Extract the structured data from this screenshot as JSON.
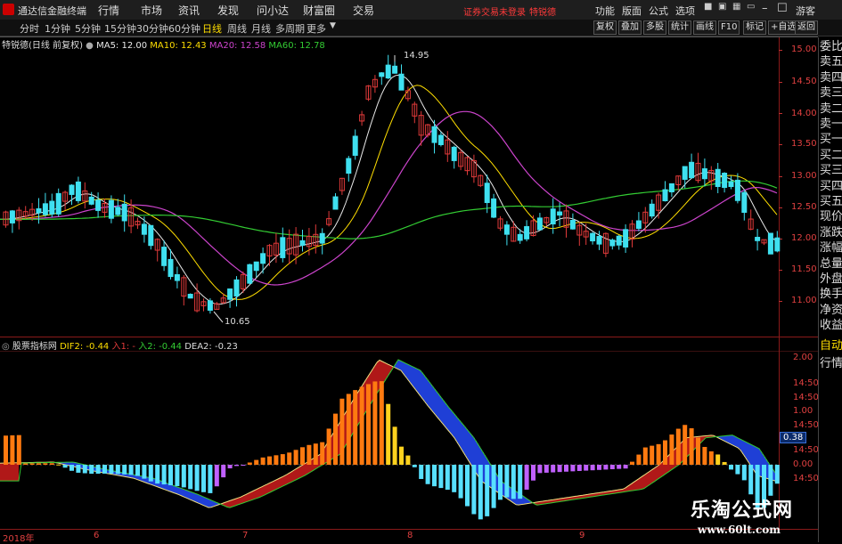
{
  "titlebar": {
    "app_name": "通达信金融终端",
    "menus": [
      "行情",
      "市场",
      "资讯",
      "发现",
      "问小达",
      "财富圈",
      "交易"
    ],
    "notice": "证券交易未登录",
    "stock_name": "特锐德",
    "right_menus": [
      "功能",
      "版面",
      "公式",
      "选项"
    ],
    "user": "游客",
    "win_min": "–",
    "win_max": "☐",
    "win_close": "✕"
  },
  "toolbar": {
    "periods": [
      "分时",
      "1分钟",
      "5分钟",
      "15分钟",
      "30分钟",
      "60分钟",
      "日线",
      "周线",
      "月线",
      "多周期",
      "更多"
    ],
    "active_period": "日线",
    "right_buttons": [
      "复权",
      "叠加",
      "多股",
      "统计",
      "画线",
      "F10",
      "标记",
      "+自选",
      "返回"
    ]
  },
  "main_info": {
    "title": "特锐德(日线 前复权)",
    "ma5": "MA5: 12.00",
    "ma10": "MA10: 12.43",
    "ma20": "MA20: 12.58",
    "ma60": "MA60: 12.78",
    "high_label": "14.95",
    "low_label": "10.65"
  },
  "indicator_info": {
    "name": "股票指标网",
    "dif": "DIF2: -0.44",
    "in1": "入1: -",
    "in2": "入2: -0.44",
    "dea": "DEA2: -0.23",
    "badge": "0.38"
  },
  "price_axis": [
    "15.00",
    "14.50",
    "14.00",
    "13.50",
    "13.00",
    "12.50",
    "12.00",
    "11.50",
    "11.00"
  ],
  "macd_axis": [
    "2.00",
    "14:50",
    "14:50",
    "1.00",
    "14:50",
    "14:50",
    "0.00",
    "14:50"
  ],
  "date_axis": [
    "2018年",
    "6",
    "7",
    "8",
    "9"
  ],
  "side_panel": [
    {
      "label": "委比",
      "hl": false
    },
    {
      "label": "卖五",
      "hl": false
    },
    {
      "label": "卖四",
      "hl": false
    },
    {
      "label": "卖三",
      "hl": false
    },
    {
      "label": "卖二",
      "hl": false
    },
    {
      "label": "卖一",
      "hl": false
    },
    {
      "label": "买一",
      "hl": false
    },
    {
      "label": "买二",
      "hl": false
    },
    {
      "label": "买三",
      "hl": false
    },
    {
      "label": "买四",
      "hl": false
    },
    {
      "label": "买五",
      "hl": false
    },
    {
      "label": "现价",
      "hl": false
    },
    {
      "label": "涨跌",
      "hl": false
    },
    {
      "label": "涨幅",
      "hl": false
    },
    {
      "label": "总量",
      "hl": false
    },
    {
      "label": "外盘",
      "hl": false
    },
    {
      "label": "换手",
      "hl": false
    },
    {
      "label": "净资",
      "hl": false
    },
    {
      "label": "收益",
      "hl": false
    },
    {
      "label": "自动",
      "hl": true
    },
    {
      "label": "行情",
      "hl": false
    }
  ],
  "watermark": {
    "line1": "乐淘公式网",
    "line2": "www.60lt.com"
  },
  "colors": {
    "up": "#e03a3a",
    "down": "#3fe0f0",
    "ma5": "#e8e8e8",
    "ma10": "#ffde00",
    "ma20": "#cc44cc",
    "ma60": "#33cc33",
    "macd_red": "#b01818",
    "macd_blue": "#1f3fd6",
    "macd_orange": "#ff7a10",
    "macd_yellow": "#ffd21e",
    "macd_violet": "#c060ff",
    "macd_cyan": "#58e0ff"
  }
}
